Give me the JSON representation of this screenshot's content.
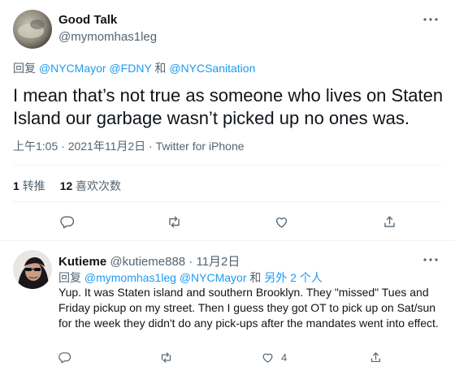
{
  "main_tweet": {
    "author_name": "Good Talk",
    "author_handle": "@mymomhas1leg",
    "reply_prefix": "回复",
    "reply_to": [
      "@NYCMayor",
      "@FDNY",
      "和",
      "@NYCSanitation"
    ],
    "text": "I mean that’s not true as someone who lives on Staten Island our garbage wasn’t picked up no ones was.",
    "timestamp": "上午1:05 · 2021年11月2日 · Twitter for iPhone",
    "stats": {
      "retweets_count": "1",
      "retweets_label": "转推",
      "likes_count": "12",
      "likes_label": "喜欢次数"
    }
  },
  "reply_tweet": {
    "author_name": "Kutieme",
    "author_handle": "@kutieme888",
    "date": "· 11月2日",
    "reply_prefix": "回复",
    "reply_to_1": "@mymomhas1leg",
    "reply_to_2": "@NYCMayor",
    "reply_to_and": "和",
    "reply_to_others": "另外 2 个人",
    "text": "Yup. It was Staten island and southern Brooklyn. They \"missed\"  Tues and Friday pickup on my street. Then I guess they got OT to pick up on Sat/sun for the week they didn't do any pick-ups after the mandates went into effect.",
    "like_count": "4"
  },
  "icons": {
    "reply": "reply-icon",
    "retweet": "retweet-icon",
    "like": "heart-icon",
    "share": "share-icon",
    "more": "more-icon"
  },
  "colors": {
    "link": "#1d9bf0",
    "muted": "#536471",
    "text": "#0f1419",
    "divider": "#eff3f4"
  }
}
